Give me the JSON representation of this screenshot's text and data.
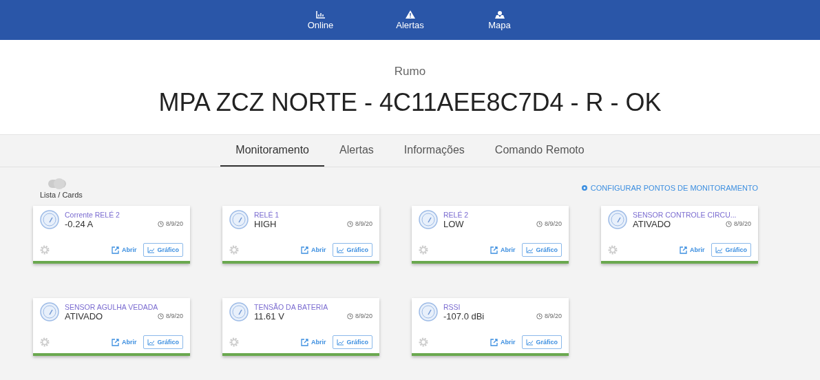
{
  "nav": [
    {
      "label": "Online"
    },
    {
      "label": "Alertas"
    },
    {
      "label": "Mapa"
    }
  ],
  "subtitle": "Rumo",
  "title": "MPA ZCZ NORTE - 4C11AEE8C7D4 - R - OK",
  "tabs": [
    {
      "label": "Monitoramento",
      "selected": true
    },
    {
      "label": "Alertas",
      "selected": false
    },
    {
      "label": "Informações",
      "selected": false
    },
    {
      "label": "Comando Remoto",
      "selected": false
    }
  ],
  "view_toggle": {
    "label": "Lista / Cards",
    "on": false
  },
  "configure_link": "CONFIGURAR PONTOS DE MONITORAMENTO",
  "cards": [
    {
      "name": "Corrente RELÉ 2",
      "value": "-0.24 A",
      "date": "8/9/20",
      "open": "Abrir",
      "chart": "Gráfico"
    },
    {
      "name": "RELÉ 1",
      "value": "HIGH",
      "date": "8/9/20",
      "open": "Abrir",
      "chart": "Gráfico"
    },
    {
      "name": "RELÉ 2",
      "value": "LOW",
      "date": "8/9/20",
      "open": "Abrir",
      "chart": "Gráfico"
    },
    {
      "name": "SENSOR CONTROLE CIRCU...",
      "value": "ATIVADO",
      "date": "8/9/20",
      "open": "Abrir",
      "chart": "Gráfico"
    },
    {
      "name": "SENSOR AGULHA VEDADA",
      "value": "ATIVADO",
      "date": "8/9/20",
      "open": "Abrir",
      "chart": "Gráfico"
    },
    {
      "name": "TENSÃO DA BATERIA",
      "value": "11.61 V",
      "date": "8/9/20",
      "open": "Abrir",
      "chart": "Gráfico"
    },
    {
      "name": "RSSI",
      "value": "-107.0 dBi",
      "date": "8/9/20",
      "open": "Abrir",
      "chart": "Gráfico"
    }
  ]
}
